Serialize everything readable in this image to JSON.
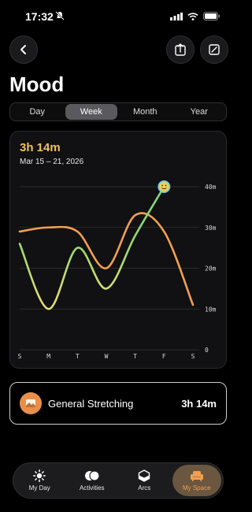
{
  "status_bar": {
    "time": "17:32"
  },
  "header": {
    "title": "Mood"
  },
  "segments": {
    "items": [
      "Day",
      "Week",
      "Month",
      "Year"
    ],
    "active": "Week"
  },
  "summary": {
    "duration": "3h 14m",
    "date_range": "Mar 15 – 21, 2026"
  },
  "chart_data": {
    "type": "line",
    "categories": [
      "S",
      "M",
      "T",
      "W",
      "T",
      "F",
      "S"
    ],
    "y_ticks": [
      "40m",
      "30m",
      "20m",
      "10m",
      "0"
    ],
    "ylim": [
      0,
      40
    ],
    "grid": true,
    "series": [
      {
        "values": [
          29,
          30,
          29,
          20,
          33,
          29,
          11
        ],
        "color": "#f0a050"
      },
      {
        "values": [
          26,
          10,
          25,
          15,
          28,
          40
        ],
        "colors": [
          "#7cd47c",
          "#f0e070"
        ],
        "end_marker": "emoji-marker"
      }
    ]
  },
  "activity": {
    "name": "General Stretching",
    "duration": "3h 14m"
  },
  "tabs": [
    {
      "label": "My Day",
      "icon": "sun-icon"
    },
    {
      "label": "Activities",
      "icon": "circles-icon"
    },
    {
      "label": "Arcs",
      "icon": "cube-icon"
    },
    {
      "label": "My Space",
      "icon": "armchair-icon",
      "active": true
    }
  ]
}
